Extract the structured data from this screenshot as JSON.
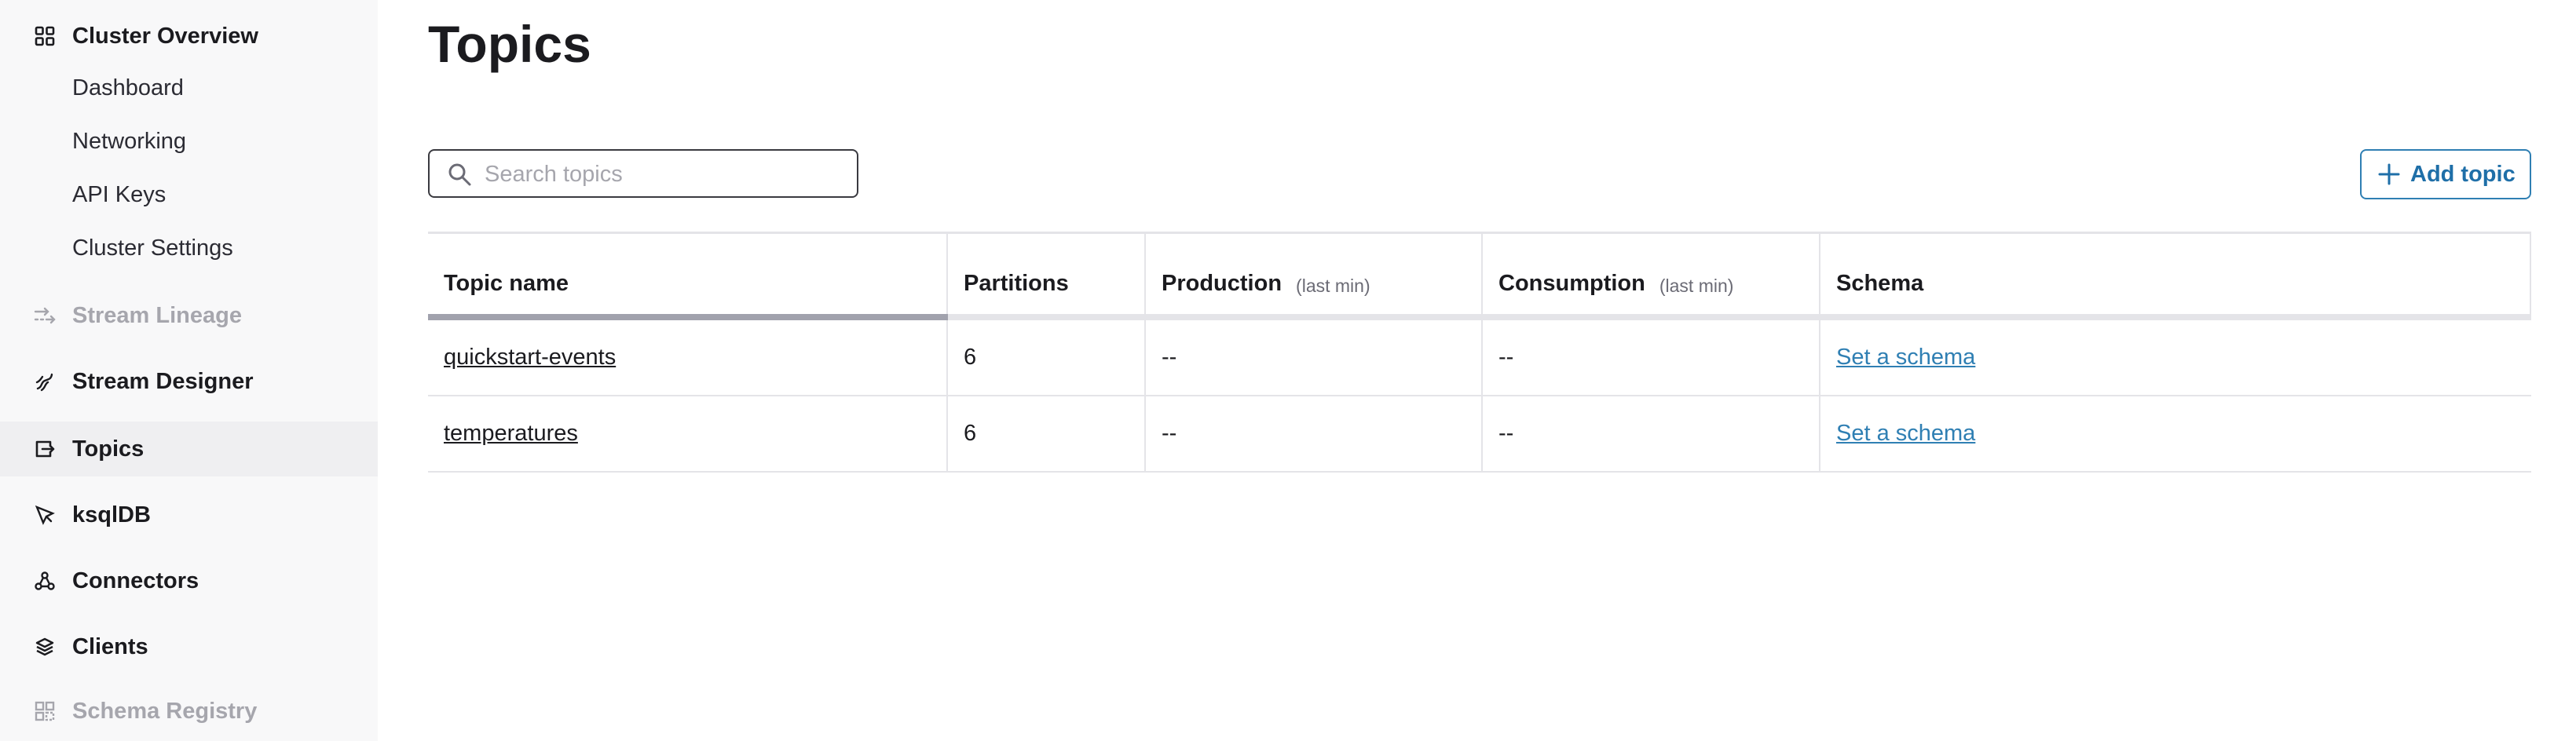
{
  "sidebar": {
    "cluster_overview": {
      "label": "Cluster Overview",
      "icon": "grid-icon",
      "children": [
        {
          "label": "Dashboard"
        },
        {
          "label": "Networking"
        },
        {
          "label": "API Keys"
        },
        {
          "label": "Cluster Settings"
        }
      ]
    },
    "items": [
      {
        "label": "Stream Lineage",
        "icon": "lineage-icon",
        "state": "disabled"
      },
      {
        "label": "Stream Designer",
        "icon": "designer-icon",
        "state": "normal"
      },
      {
        "label": "Topics",
        "icon": "topics-icon",
        "state": "active"
      },
      {
        "label": "ksqlDB",
        "icon": "ksqldb-icon",
        "state": "normal"
      },
      {
        "label": "Connectors",
        "icon": "connectors-icon",
        "state": "normal"
      },
      {
        "label": "Clients",
        "icon": "clients-icon",
        "state": "normal"
      },
      {
        "label": "Schema Registry",
        "icon": "schema-registry-icon",
        "state": "disabled"
      }
    ]
  },
  "main": {
    "title": "Topics",
    "search": {
      "placeholder": "Search topics",
      "value": ""
    },
    "add_button": {
      "label": "Add topic"
    },
    "table": {
      "columns": [
        {
          "label": "Topic name",
          "hint": ""
        },
        {
          "label": "Partitions",
          "hint": ""
        },
        {
          "label": "Production",
          "hint": "(last min)"
        },
        {
          "label": "Consumption",
          "hint": "(last min)"
        },
        {
          "label": "Schema",
          "hint": ""
        }
      ],
      "rows": [
        {
          "name": "quickstart-events",
          "partitions": "6",
          "production": "--",
          "consumption": "--",
          "schema": "Set a schema"
        },
        {
          "name": "temperatures",
          "partitions": "6",
          "production": "--",
          "consumption": "--",
          "schema": "Set a schema"
        }
      ]
    }
  },
  "colors": {
    "accent": "#2f7fb3",
    "sidebar_bg": "#f8f8f9",
    "active_bg": "#efeff1",
    "disabled_text": "#a6a6ad"
  }
}
